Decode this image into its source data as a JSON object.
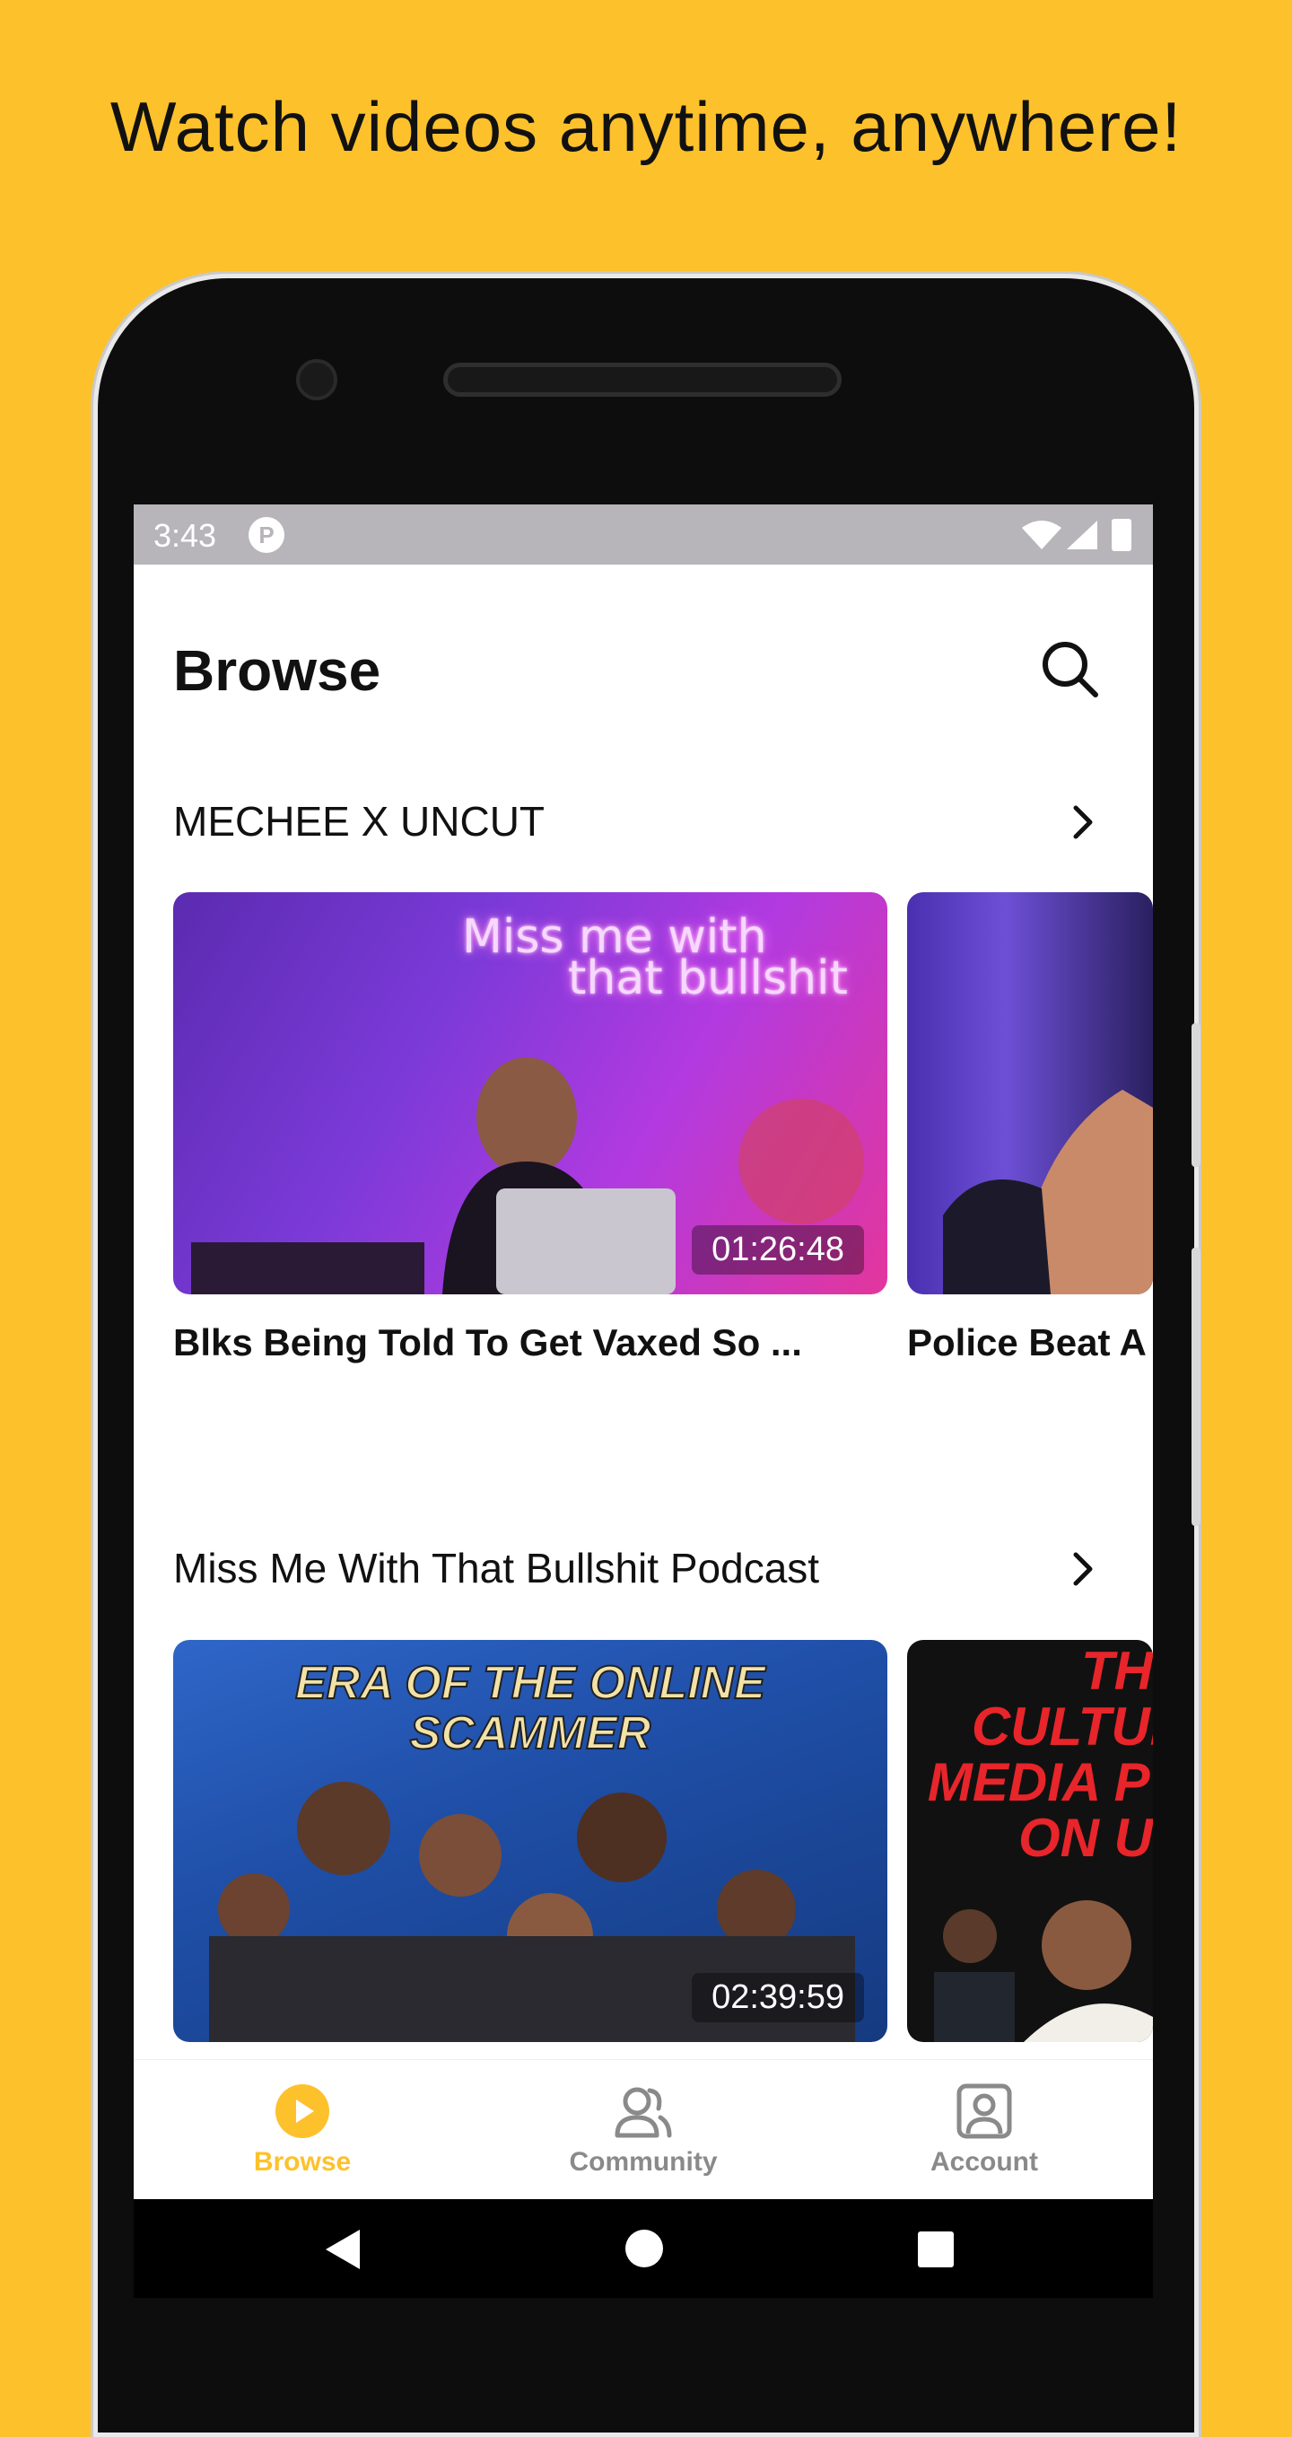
{
  "promo": {
    "headline": "Watch videos anytime, anywhere!"
  },
  "status_bar": {
    "time": "3:43",
    "app_icon_letter": "P"
  },
  "header": {
    "title": "Browse"
  },
  "sections": [
    {
      "title": "MECHEE X UNCUT",
      "videos": [
        {
          "title": "Blks Being Told To Get Vaxed So ...",
          "duration": "01:26:48",
          "thumb_text": [
            "Miss me with",
            "that bullshit"
          ]
        },
        {
          "title": "Police Beat A"
        }
      ]
    },
    {
      "title": "Miss Me With That Bullshit Podcast",
      "videos": [
        {
          "duration": "02:39:59",
          "thumb_text": [
            "ERA OF THE ONLINE",
            "SCAMMER"
          ]
        },
        {
          "thumb_text": [
            "THE",
            "CULTUR",
            "MEDIA PU",
            "ON US"
          ]
        }
      ]
    }
  ],
  "bottom_nav": [
    {
      "label": "Browse",
      "icon": "play-circle-icon",
      "active": true
    },
    {
      "label": "Community",
      "icon": "people-icon",
      "active": false
    },
    {
      "label": "Account",
      "icon": "account-icon",
      "active": false
    }
  ],
  "colors": {
    "accent": "#FDC12B",
    "inactive": "#8a8a8a",
    "text": "#111111"
  }
}
